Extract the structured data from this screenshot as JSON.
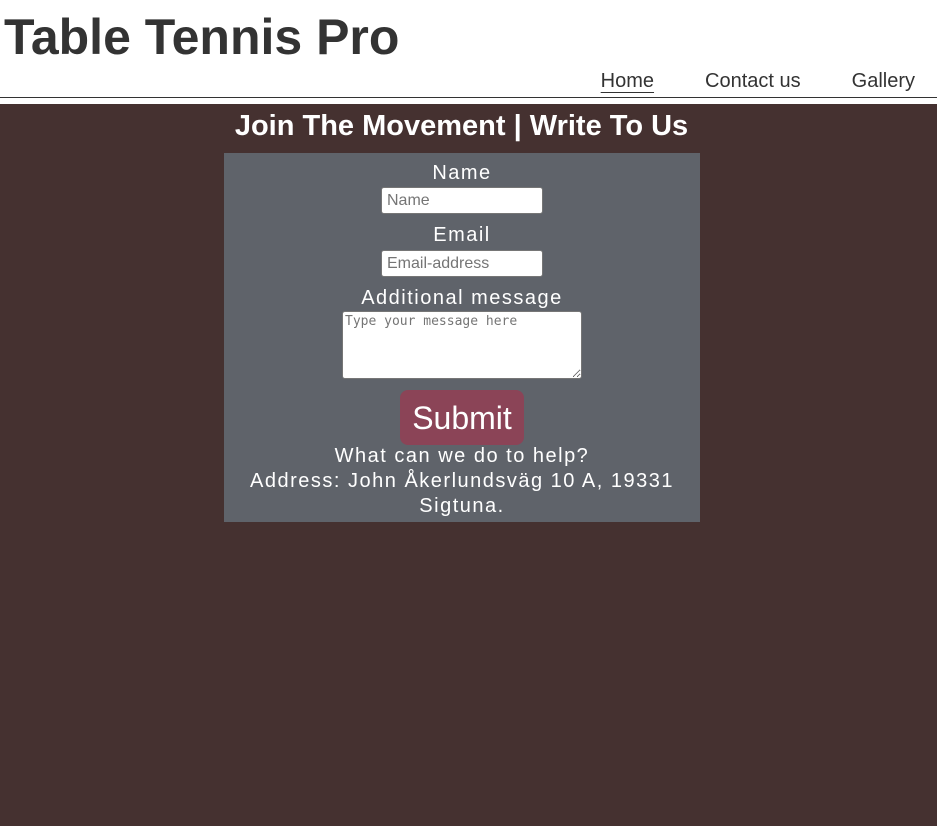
{
  "header": {
    "site_title": "Table Tennis Pro",
    "nav": [
      {
        "label": "Home",
        "active": true
      },
      {
        "label": "Contact us",
        "active": false
      },
      {
        "label": "Gallery",
        "active": false
      }
    ]
  },
  "main": {
    "heading": "Join The Movement | Write To Us",
    "form": {
      "name_label": "Name",
      "name_placeholder": "Name",
      "email_label": "Email",
      "email_placeholder": "Email-address",
      "message_label": "Additional message",
      "message_placeholder": "Type your message here",
      "submit_label": "Submit"
    },
    "help_text": "What can we do to help?",
    "address_line1": "Address: John Åkerlundsväg 10 A, 19331",
    "address_line2": "Sigtuna."
  },
  "colors": {
    "background": "#453130",
    "panel": "#5f636a",
    "submit": "#8b4457",
    "header_text": "#333333"
  }
}
